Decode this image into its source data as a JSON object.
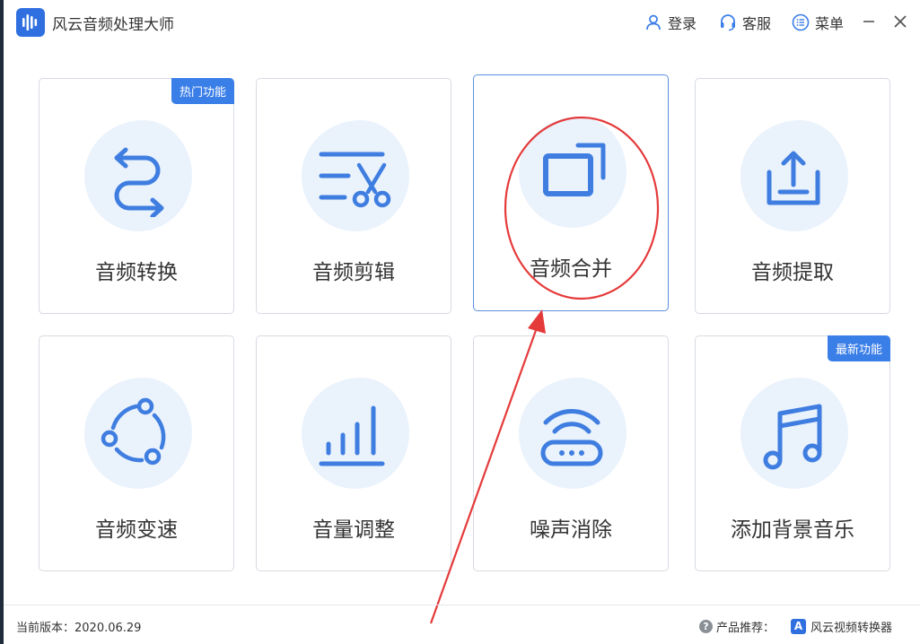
{
  "app": {
    "title": "风云音频处理大师"
  },
  "toolbar": {
    "login": "登录",
    "service": "客服",
    "menu": "菜单"
  },
  "cards": [
    {
      "label": "音频转换",
      "badge": "热门功能",
      "icon": "convert-arrows-icon"
    },
    {
      "label": "音频剪辑",
      "badge": "",
      "icon": "scissors-icon"
    },
    {
      "label": "音频合并",
      "badge": "",
      "icon": "merge-windows-icon"
    },
    {
      "label": "音频提取",
      "badge": "",
      "icon": "upload-tray-icon"
    },
    {
      "label": "音频变速",
      "badge": "",
      "icon": "speed-cycle-icon"
    },
    {
      "label": "音量调整",
      "badge": "",
      "icon": "volume-bars-icon"
    },
    {
      "label": "噪声消除",
      "badge": "",
      "icon": "noise-router-icon"
    },
    {
      "label": "添加背景音乐",
      "badge": "最新功能",
      "icon": "music-note-icon"
    }
  ],
  "footer": {
    "version": "当前版本：2020.06.29",
    "recommend_label": "产品推荐：",
    "recommend_product": "风云视频转换器",
    "recommend_logo_letter": "A"
  },
  "colors": {
    "accent": "#3a7ee8",
    "icon": "#3f7ee0",
    "blob": "#eaf2fc",
    "annotation": "#e53a3a"
  }
}
